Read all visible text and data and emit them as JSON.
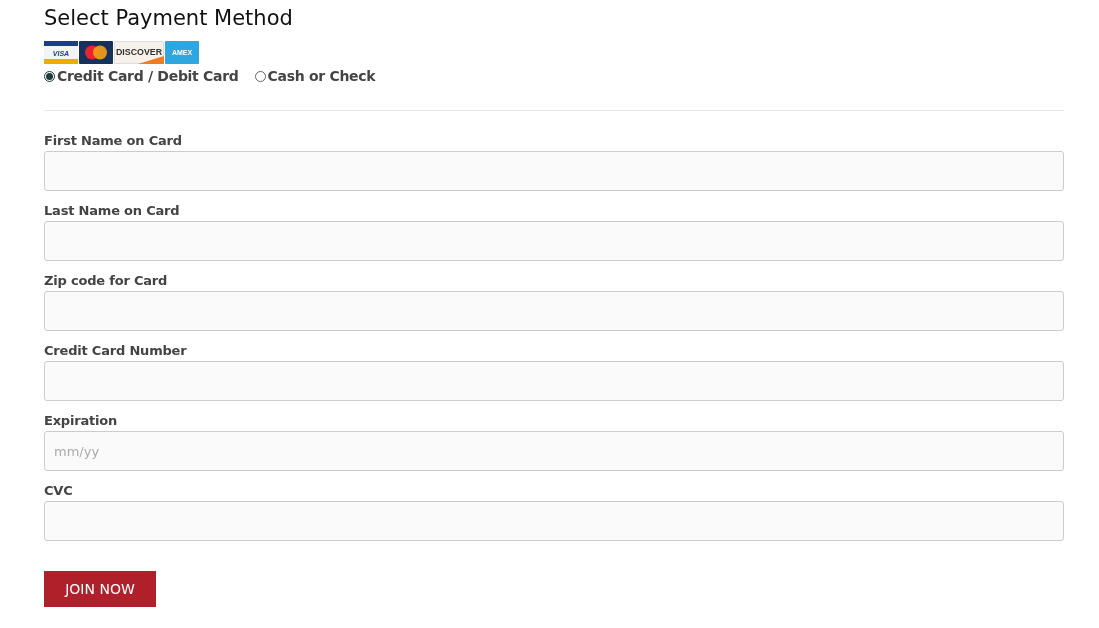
{
  "title": "Select Payment Method",
  "cards": [
    {
      "kind": "visa",
      "label": "VISA"
    },
    {
      "kind": "mastercard"
    },
    {
      "kind": "discover",
      "label": "DISCOVER"
    },
    {
      "kind": "amex",
      "label": "AMEX"
    }
  ],
  "payment_options": [
    {
      "label": "Credit Card / Debit Card",
      "selected": true
    },
    {
      "label": "Cash or Check",
      "selected": false
    }
  ],
  "fields": [
    {
      "label": "First Name on Card"
    },
    {
      "label": "Last Name on Card"
    },
    {
      "label": "Zip code for Card"
    },
    {
      "label": "Credit Card Number"
    },
    {
      "label": "Expiration",
      "placeholder": "mm/yy"
    },
    {
      "label": "CVC"
    }
  ],
  "submit_button": "JOIN NOW"
}
